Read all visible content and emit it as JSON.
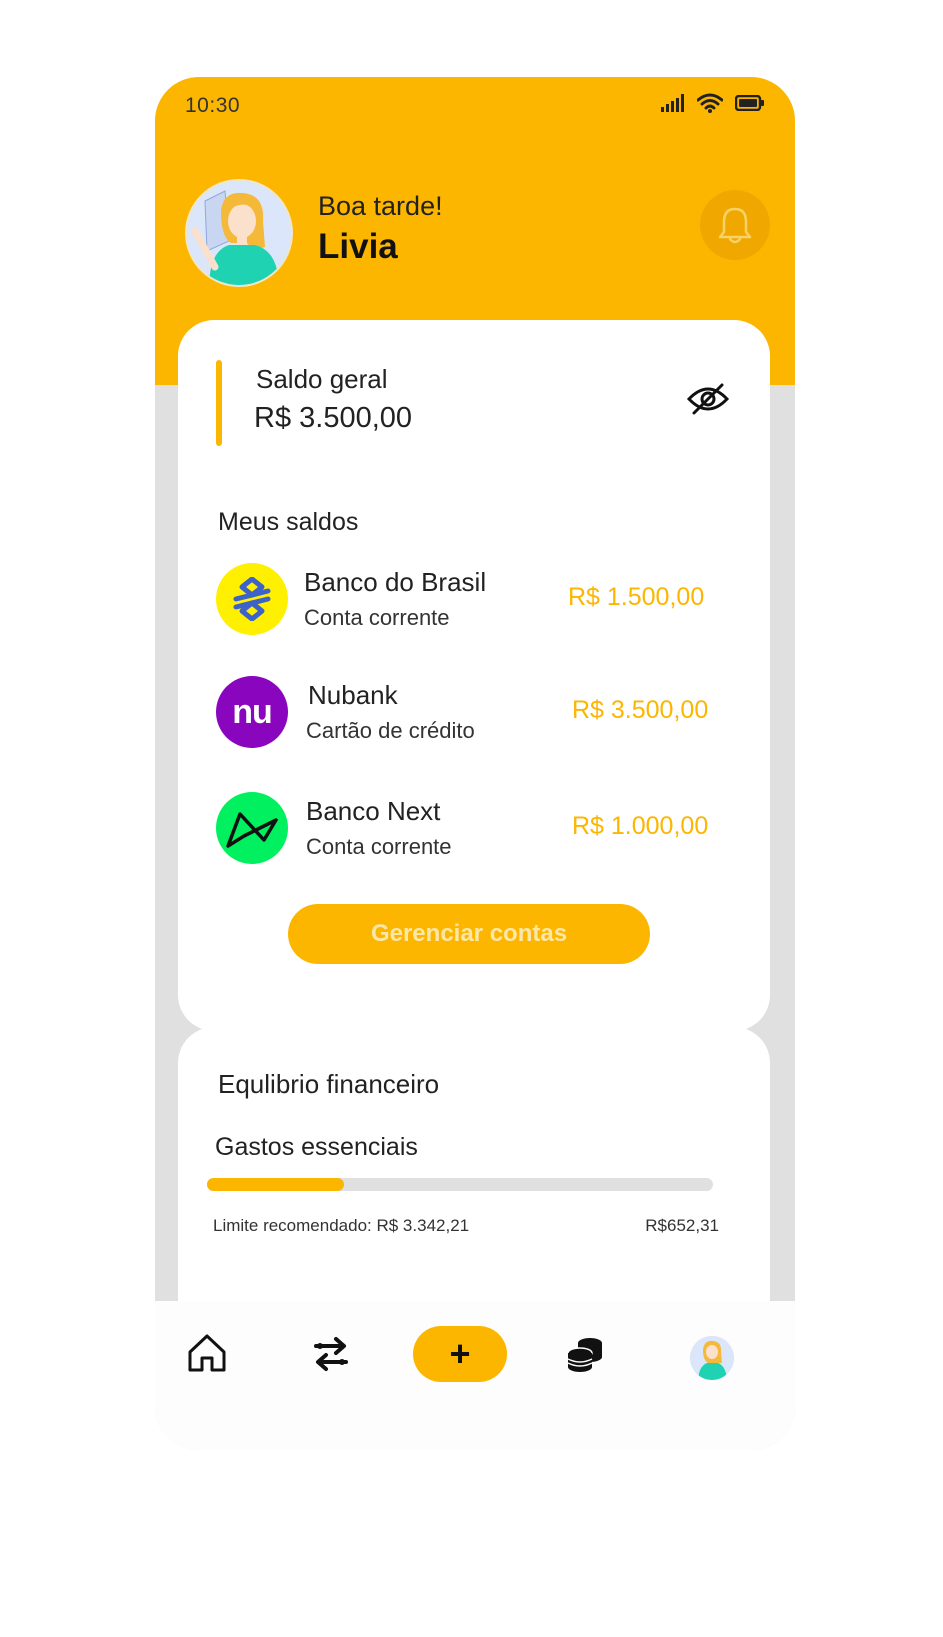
{
  "status_bar": {
    "time": "10:30"
  },
  "header": {
    "greeting": "Boa tarde!",
    "user_name": "Livia"
  },
  "balance": {
    "label": "Saldo geral",
    "value": "R$ 3.500,00"
  },
  "my_balances": {
    "title": "Meus saldos",
    "accounts": [
      {
        "name": "Banco do Brasil",
        "type": "Conta corrente",
        "amount": "R$ 1.500,00",
        "logo_color": "#ffef00",
        "logo_icon": "banco-do-brasil-logo"
      },
      {
        "name": "Nubank",
        "type": "Cartão de crédito",
        "amount": "R$ 3.500,00",
        "logo_color": "#8a05be",
        "logo_icon": "nubank-logo",
        "logo_text": "nu"
      },
      {
        "name": "Banco Next",
        "type": "Conta corrente",
        "amount": "R$ 1.000,00",
        "logo_color": "#00ff5f",
        "logo_icon": "next-logo"
      }
    ],
    "manage_button": "Gerenciar contas"
  },
  "financial_balance": {
    "title": "Equlibrio financeiro",
    "category": "Gastos essenciais",
    "progress_fraction": 0.27,
    "limit_text": "Limite recomendado: R$ 3.342,21",
    "spent_text": "R$652,31"
  },
  "nav": {
    "items": [
      "home-icon",
      "transfer-icon",
      "add-icon",
      "coins-icon",
      "profile-avatar"
    ],
    "add_label": "+"
  },
  "colors": {
    "brand": "#fdb600",
    "background": "#e0e0e0",
    "card": "#ffffff"
  }
}
